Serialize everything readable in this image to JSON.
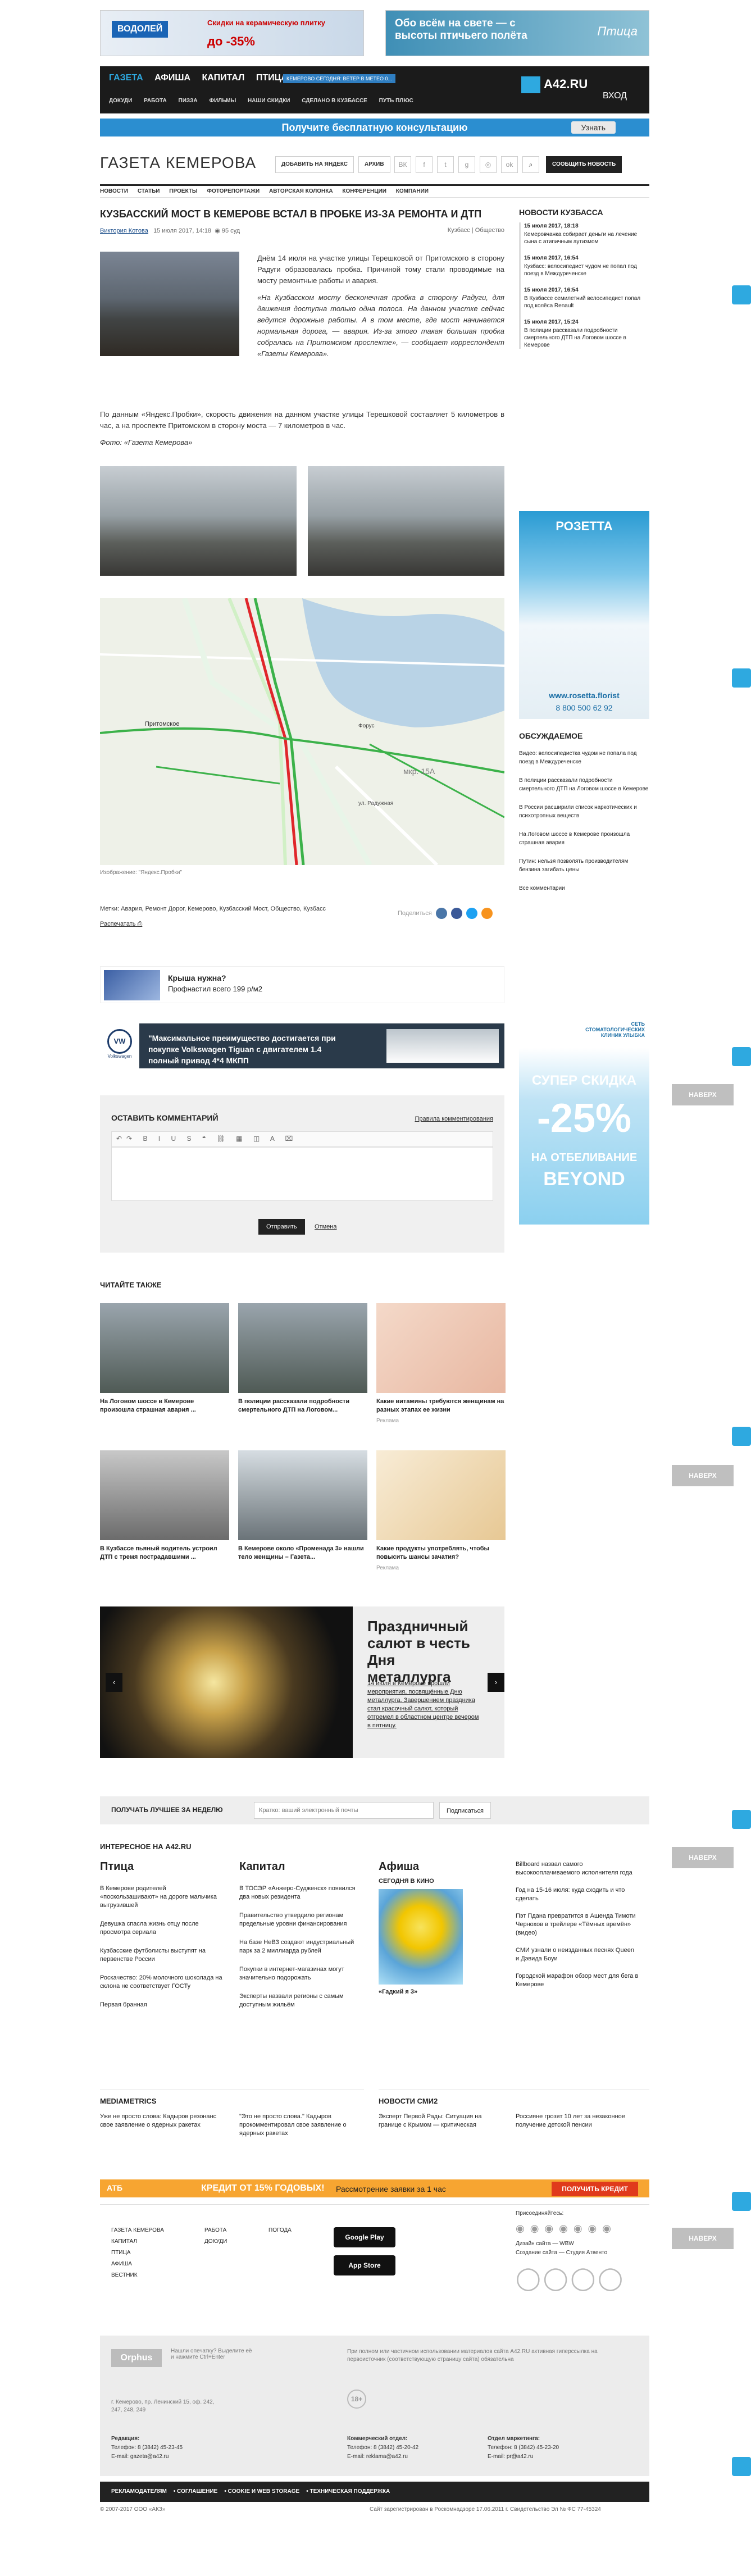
{
  "ads_top": {
    "left_logo": "ВОДОЛЕЙ",
    "left_text": "Скидки на керамическую плитку",
    "left_discount": "до -35%",
    "right_text": "Обо всём на свете — с высоты птичьего полёта",
    "right_brand": "Птица"
  },
  "topnav": {
    "main_items": [
      "ГАЗЕТА",
      "АФИША",
      "КАПИТАЛ",
      "ПТИЦА"
    ],
    "badge": "КЕМЕРОВО СЕГОДНЯ: ВЕТЕР В МЕТЕО 0...",
    "sub_items": [
      "ДОКУДИ",
      "РАБОТА",
      "ПИЗЗА",
      "ФИЛЬМЫ",
      "НАШИ СКИДКИ",
      "СДЕЛАНО В КУЗБАССЕ",
      "ПУТЬ ПЛЮС"
    ],
    "portal": "A42.RU",
    "login": "ВХОД"
  },
  "consult": {
    "text": "Получите бесплатную консультацию",
    "button": "Узнать"
  },
  "site_head": {
    "name": "ГАЗЕТА КЕМЕРОВА",
    "add_yandex": "ДОБАВИТЬ НА ЯНДЕКС",
    "archive": "АРХИВ",
    "social": [
      "ВК",
      "f",
      "t",
      "g",
      "◎",
      "ok"
    ],
    "report": "СООБЩИТЬ НОВОСТЬ"
  },
  "sections": [
    "НОВОСТИ",
    "СТАТЬИ",
    "ПРОЕКТЫ",
    "ФОТОРЕПОРТАЖИ",
    "АВТОРСКАЯ КОЛОНКА",
    "КОНФЕРЕНЦИИ",
    "КОМПАНИИ"
  ],
  "article": {
    "title": "КУЗБАССКИЙ МОСТ В КЕМЕРОВЕ ВСТАЛ В ПРОБКЕ ИЗ-ЗА РЕМОНТА И ДТП",
    "author": "Виктория Котова",
    "date": "15 июля 2017, 14:18",
    "views": "95 суд",
    "rubrics": "Кузбасс | Общество",
    "p1": "Днём 14 июля на участке улицы Терешковой от Притомского в сторону Радуги образовалась пробка. Причиной тому стали проводимые на мосту ремонтные работы и авария.",
    "p2": "«На Кузбасском мосту бесконечная пробка в сторону Радуги, для движения доступна только одна полоса. На данном участке сейчас ведутся дорожные работы. А в том месте, где мост начинается нормальная дорога, — авария. Из-за этого такая большая пробка собралась на Притомском проспекте», — сообщает корреспондент «Газеты Кемерова».",
    "p3": "По данным «Яндекс.Пробки», скорость движения на данном участке улицы Терешковой составляет 5 километров в час, а на проспекте Притомском в сторону моста — 7 километров в час.",
    "photo_credit": "Фото: «Газета Кемерова»",
    "map_labels": {
      "district1": "Притомское",
      "district2": "Форус",
      "district3": "мкр. 15А",
      "street": "ул. Радужная"
    },
    "map_caption": "Изображение: \"Яндекс.Пробки\"",
    "tags": "Метки: Авария, Ремонт Дорог, Кемерово, Кузбасский Мост, Общество, Кузбасс",
    "print": "Распечатать",
    "share": "Поделиться"
  },
  "ad_roof": {
    "title": "Крыша нужна?",
    "text": "Профнастил всего 199 р/м2"
  },
  "ad_vw": {
    "brand": "Volkswagen",
    "text": "\"Максимальное преимущество достигается при покупке Volkswagen Tiguan с двигателем 1.4 полный привод 4*4 МКПП"
  },
  "comments": {
    "title": "ОСТАВИТЬ КОММЕНТАРИЙ",
    "rules": "Правила комментирования",
    "send": "Отправить",
    "cancel": "Отмена"
  },
  "read_also": {
    "title": "ЧИТАЙТЕ ТАКЖЕ",
    "items": [
      {
        "title": "На Логовом шоссе в Кемерове произошла страшная авария ..."
      },
      {
        "title": "В полиции рассказали подробности смертельного ДТП на Логовом..."
      },
      {
        "title": "Какие витамины требуются женщинам на разных этапах ее жизни",
        "sub": "Реклама"
      },
      {
        "title": "В Кузбассе пьяный водитель устроил ДТП с тремя пострадавшими ..."
      },
      {
        "title": "В Кемерове около «Променада 3» нашли тело женщины – Газета..."
      },
      {
        "title": "Какие продукты употреблять, чтобы повысить шансы зачатия?",
        "sub": "Реклама"
      }
    ]
  },
  "slider": {
    "title": "Праздничный салют в честь Дня металлурга",
    "text": "14 июля в Кемерове прошли мероприятия, посвящённые Дню металлурга. Завершением праздника стал красочный салют, который отгремел в областном центре вечером в пятницу."
  },
  "newsletter": {
    "label": "ПОЛУЧАТЬ ЛУЧШЕЕ ЗА НЕДЕЛЮ",
    "placeholder": "Кратко: ваший электронный почты",
    "button": "Подписаться"
  },
  "a42": {
    "title": "ИНТЕРЕСНОЕ НА A42.RU",
    "ptica": {
      "h": "Птица",
      "items": [
        "В Кемерове родителей «поскользашивают» на дороге мальчика выгрузившей",
        "Девушка спасла жизнь отцу после просмотра сериала",
        "Кузбасские футболисты выступят на первенстве России",
        "Роскачество: 20% молочного шоколада на склона не соответствует ГОСТу",
        "Первая бранная"
      ]
    },
    "kapital": {
      "h": "Капитал",
      "items": [
        "В ТОСЭР «Анжеро-Судженск» появился два новых резидента",
        "Правительство утвердило регионам предельные уровни финансирования",
        "На базе НеВЗ создают индустриальный парк за 2 миллиарда рублей",
        "Покупки в интернет-магазинах могут значительно подорожать",
        "Эксперты назвали регионы с самым доступным жильём"
      ]
    },
    "afisha": {
      "h": "Афиша",
      "cinema": "СЕГОДНЯ В КИНО",
      "film": "«Гадкий я 3»",
      "items": [
        "Billboard назвал самого высокооплачиваемого исполнителя года",
        "Год на 15-16 июля: куда сходить и что сделать",
        "Пэт Пдана превратится в Ашенда Тимоти Чернохов в трейлере «Тёмных времён» (видео)",
        "СМИ узнали о неизданных песнях Queen и Дэвида Боуи",
        "Городской марафон обзор мест для бега в Кемерове"
      ]
    },
    "mediametrics": {
      "h": "MEDIAMETRICS",
      "items": [
        "Уже не просто слова: Кадыров резонанс свое заявление о ядерных ракетах",
        "\"Это не просто слова.\" Кадыров прокомментировал свое заявление о ядерных ракетах"
      ]
    },
    "smi2": {
      "h": "НОВОСТИ СМИ2",
      "items": [
        "Эксперт Первой Рады: Ситуация на границе с Крымом — критическая",
        "Россияне грозят 10 лет за незаконное получение детской пенсии"
      ]
    }
  },
  "atb": {
    "brand": "АТБ",
    "text": "КРЕДИТ ОТ 15% ГОДОВЫХ!",
    "text2": "Рассмотрение заявки за 1 час",
    "button": "ПОЛУЧИТЬ КРЕДИТ"
  },
  "footer": {
    "col1": [
      "ГАЗЕТА КЕМЕРОВА",
      "КАПИТАЛ",
      "ПТИЦА",
      "АФИША",
      "ВЕСТНИК"
    ],
    "col2": [
      "РАБОТА",
      "ДОКУДИ"
    ],
    "col3": [
      "ПОГОДА"
    ],
    "google_play": "Google Play",
    "app_store": "App Store",
    "social_label": "Присоединяйтесь:",
    "design": "Дизайн сайта — WBW",
    "dev": "Создание сайта — Студия Атвенто"
  },
  "gray_footer": {
    "orphus": "Orphus",
    "orphus_text": "Нашли опечатку? Выделите её и нажмите Ctrl+Enter",
    "rights": "При полном или частичном использовании материалов сайта A42.RU активная гиперссылка на первоисточник (соответствующую страницу сайта) обязательна",
    "age": "18+",
    "address": "г. Кемерово, пр. Ленинский 15, оф. 242, 247, 248, 249",
    "editorial": "Редакция:",
    "editorial_phone": "Телефон: 8 (3842) 45-23-45",
    "editorial_email": "E-mail: gazeta@a42.ru",
    "commercial": "Коммерческий отдел:",
    "commercial_phone": "Телефон: 8 (3842) 45-20-42",
    "commercial_email": "E-mail: reklama@a42.ru",
    "marketing": "Отдел маркетинга:",
    "marketing_phone": "Телефон: 8 (3842) 45-23-20",
    "marketing_email": "E-mail: pr@a42.ru"
  },
  "black_footer": [
    "РЕКЛАМОДАТЕЛЯМ",
    "СОГЛАШЕНИЕ",
    "COOKIE И WEB STORAGE",
    "ТЕХНИЧЕСКАЯ ПОДДЕРЖКА"
  ],
  "copyright": "© 2007-2017 ООО «АКЗ»",
  "registration": "Сайт зарегистрирован в Роскомнадзоре 17.06.2011 г. Свидетельство Эл № ФС 77-45324",
  "sidebar": {
    "news_title": "НОВОСТИ КУЗБАССА",
    "news": [
      {
        "time": "15 июля 2017, 18:18",
        "text": "Кемеровчанка собирает деньги на лечение сына с атипичным аутизмом"
      },
      {
        "time": "15 июля 2017, 16:54",
        "text": "Кузбасс: велосипедист чудом не попал под поезд в Междуреченске"
      },
      {
        "time": "15 июля 2017, 16:54",
        "text": "В Кузбассе семилетний велосипедист попал под колёса Renault"
      },
      {
        "time": "15 июля 2017, 15:24",
        "text": "В полиции рассказали подробности смертельного ДТП на Логовом шоссе в Кемерове"
      }
    ],
    "ad_rozetta": {
      "brand": "РОЗЕТТА",
      "site": "www.rosetta.florist",
      "phone": "8 800 500 62 92"
    },
    "discussed_title": "ОБСУЖДАЕМОЕ",
    "discussed": [
      "Видео: велосипедистка чудом не попала под поезд в Междуреченске",
      "В полиции рассказали подробности смертельного ДТП на Логовом шоссе в Кемерове",
      "В России расширили список наркотических и психотропных веществ",
      "На Логовом шоссе в Кемерове произошла страшная авария",
      "Путин: нельзя позволять производителям бензина загибать цены"
    ],
    "all_comments": "Все комментарии",
    "ad_ulybka": {
      "brand": "СЕТЬ СТОМАТОЛОГИЧЕСКИХ КЛИНИК УЛЫБКА",
      "title": "СУПЕР СКИДКА",
      "discount": "-25%",
      "text": "НА ОТБЕЛИВАНИЕ",
      "brand2": "BEYOND"
    }
  },
  "naverh": "НАВЕРХ"
}
